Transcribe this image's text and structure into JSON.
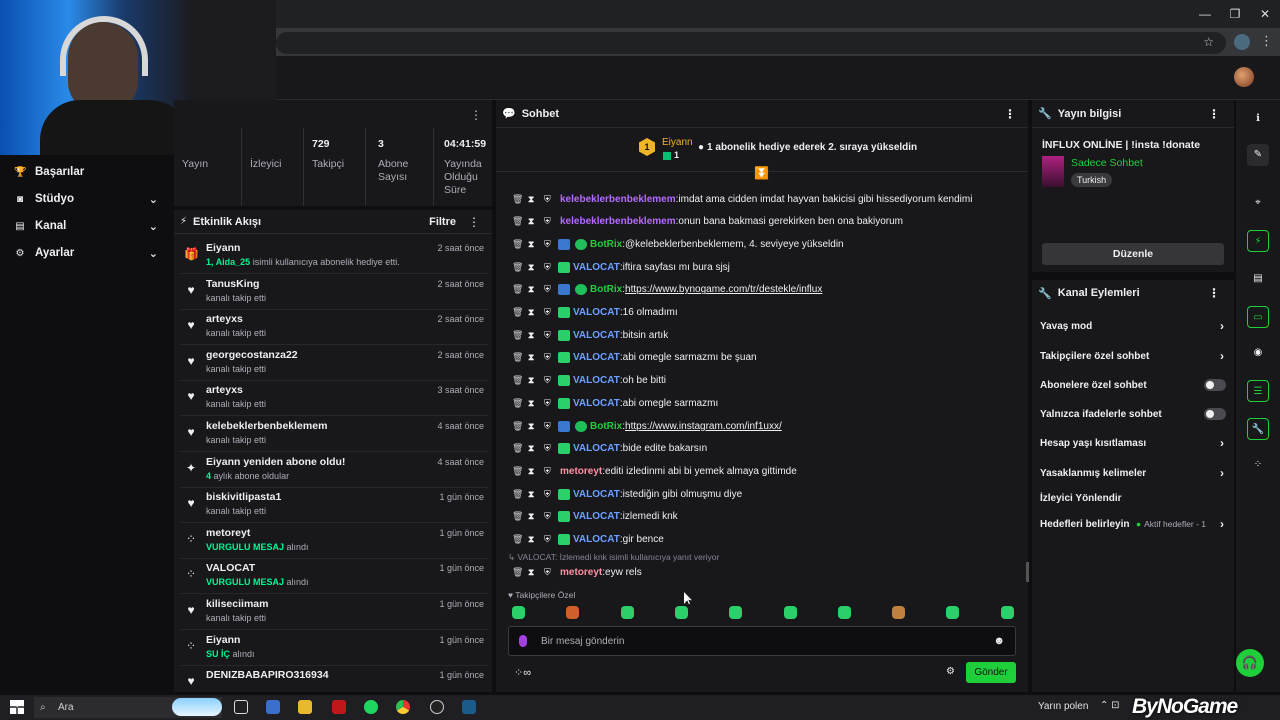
{
  "browser": {
    "window_controls": [
      "—",
      "❐",
      "✕"
    ]
  },
  "sidebar": {
    "items": [
      {
        "label": "Başarılar",
        "icon": "trophy-icon",
        "has_chevron": false
      },
      {
        "label": "Stüdyo",
        "icon": "studio-icon",
        "has_chevron": true
      },
      {
        "label": "Kanal",
        "icon": "channel-icon",
        "has_chevron": true
      },
      {
        "label": "Ayarlar",
        "icon": "gear-icon",
        "has_chevron": true
      }
    ]
  },
  "stats": [
    {
      "value": "",
      "label": "Yayın"
    },
    {
      "value": "",
      "label": "İzleyici"
    },
    {
      "value": "729",
      "label": "Takipçi"
    },
    {
      "value": "3",
      "label": "Abone Sayısı"
    },
    {
      "value": "04:41:59",
      "label": "Yayında Olduğu Süre"
    }
  ],
  "activity": {
    "title": "Etkinlik Akışı",
    "filter_label": "Filtre",
    "items": [
      {
        "icon": "gift-icon",
        "name": "Eiyann",
        "highlight": "1, Aida_25",
        "sub": " isimli kullanıcıya abonelik hediye etti.",
        "time": "2 saat önce"
      },
      {
        "icon": "heart-icon",
        "name": "TanusKing",
        "highlight": "",
        "sub": "kanalı takip etti",
        "time": "2 saat önce"
      },
      {
        "icon": "heart-icon",
        "name": "arteyxs",
        "highlight": "",
        "sub": "kanalı takip etti",
        "time": "2 saat önce"
      },
      {
        "icon": "heart-icon",
        "name": "georgecostanza22",
        "highlight": "",
        "sub": "kanalı takip etti",
        "time": "2 saat önce"
      },
      {
        "icon": "heart-icon",
        "name": "arteyxs",
        "highlight": "",
        "sub": "kanalı takip etti",
        "time": "3 saat önce"
      },
      {
        "icon": "heart-icon",
        "name": "kelebeklerbenbeklemem",
        "highlight": "",
        "sub": "kanalı takip etti",
        "time": "4 saat önce"
      },
      {
        "icon": "sparkle-icon",
        "name": "Eiyann yeniden abone oldu!",
        "highlight": "4",
        "sub": " aylık abone oldular",
        "time": "4 saat önce"
      },
      {
        "icon": "heart-icon",
        "name": "biskivitlipasta1",
        "highlight": "",
        "sub": "kanalı takip etti",
        "time": "1 gün önce"
      },
      {
        "icon": "points-icon",
        "name": "metoreyt",
        "highlight": "VURGULU MESAJ",
        "sub": " alındı",
        "time": "1 gün önce"
      },
      {
        "icon": "points-icon",
        "name": "VALOCAT",
        "highlight": "VURGULU MESAJ",
        "sub": " alındı",
        "time": "1 gün önce"
      },
      {
        "icon": "heart-icon",
        "name": "kiliseciimam",
        "highlight": "",
        "sub": "kanalı takip etti",
        "time": "1 gün önce"
      },
      {
        "icon": "points-icon",
        "name": "Eiyann",
        "highlight": "SU İÇ",
        "sub": " alındı",
        "time": "1 gün önce"
      },
      {
        "icon": "heart-icon",
        "name": "DENIZBABAPIRO316934",
        "highlight": "",
        "sub": "",
        "time": "1 gün önce"
      }
    ]
  },
  "chat": {
    "title": "Sohbet",
    "pinned": {
      "rank": "1",
      "name": "Eiyann",
      "count": "1",
      "message": "1 abonelik hediye ederek 2. sıraya yükseldin"
    },
    "messages": [
      {
        "badge": "",
        "user": "kelebeklerbenbeklemem",
        "color": "#b46bff",
        "text": "imdat ama cidden imdat hayvan bakicisi gibi hissediyorum kendimi",
        "link": false
      },
      {
        "badge": "",
        "user": "kelebeklerbenbeklemem",
        "color": "#b46bff",
        "text": "onun bana bakmasi gerekirken ben ona bakiyorum",
        "link": false
      },
      {
        "badge": "bot",
        "user": "BotRix",
        "color": "#1fcf3a",
        "text": "@kelebeklerbenbeklemem, 4. seviyeye yükseldin",
        "link": false
      },
      {
        "badge": "sub",
        "user": "VALOCAT",
        "color": "#6ea0ff",
        "text": "iftira sayfası mı bura sjsj",
        "link": false
      },
      {
        "badge": "bot",
        "user": "BotRix",
        "color": "#1fcf3a",
        "text": "https://www.bynogame.com/tr/destekle/influx",
        "link": true
      },
      {
        "badge": "sub",
        "user": "VALOCAT",
        "color": "#6ea0ff",
        "text": "16 olmadımı",
        "link": false
      },
      {
        "badge": "sub",
        "user": "VALOCAT",
        "color": "#6ea0ff",
        "text": "bitsin artık",
        "link": false
      },
      {
        "badge": "sub",
        "user": "VALOCAT",
        "color": "#6ea0ff",
        "text": "abi omegle sarmazmı be şuan",
        "link": false
      },
      {
        "badge": "sub",
        "user": "VALOCAT",
        "color": "#6ea0ff",
        "text": "oh be bitti",
        "link": false
      },
      {
        "badge": "sub",
        "user": "VALOCAT",
        "color": "#6ea0ff",
        "text": "abi omegle sarmazmı",
        "link": false
      },
      {
        "badge": "bot",
        "user": "BotRix",
        "color": "#1fcf3a",
        "text": "https://www.instagram.com/inf1uxx/",
        "link": true
      },
      {
        "badge": "sub",
        "user": "VALOCAT",
        "color": "#6ea0ff",
        "text": "bide edite bakarsın",
        "link": false
      },
      {
        "badge": "",
        "user": "metoreyt",
        "color": "#ff8fa3",
        "text": "editi izledinmi abi bi yemek almaya gittimde",
        "link": false
      },
      {
        "badge": "sub",
        "user": "VALOCAT",
        "color": "#6ea0ff",
        "text": "istediğin gibi olmuşmu diye",
        "link": false
      },
      {
        "badge": "sub",
        "user": "VALOCAT",
        "color": "#6ea0ff",
        "text": "izlemedi knk",
        "link": false
      },
      {
        "badge": "sub",
        "user": "VALOCAT",
        "color": "#6ea0ff",
        "text": "gir bence",
        "link": false
      },
      {
        "badge": "",
        "user": "metoreyt",
        "color": "#ff8fa3",
        "text": "eyw rels",
        "link": false
      }
    ],
    "reply_note": "↳ VALOCAT: İzlemedi knk isimli kullanıcıya yanıt veriyor",
    "emote_label": "♥ Takipçilere Özel",
    "emote_colors": [
      "#2bd06a",
      "#d0602a",
      "#2bd06a",
      "#2bd06a",
      "#2bd06a",
      "#2bd06a",
      "#2bd06a",
      "#c08040",
      "#2bd06a",
      "#2bd06a"
    ],
    "input_placeholder": "Bir mesaj gönderin",
    "send_label": "Gönder"
  },
  "stream_info": {
    "title": "Yayın bilgisi",
    "stream_title": "İNFLUX ONLİNE | !insta !donate",
    "category": "Sadece Sohbet",
    "tag": "Turkish",
    "edit_label": "Düzenle"
  },
  "channel_actions": {
    "title": "Kanal Eylemleri",
    "rows": [
      {
        "label": "Yavaş mod",
        "control": "chevron"
      },
      {
        "label": "Takipçilere özel sohbet",
        "control": "chevron"
      },
      {
        "label": "Abonelere özel sohbet",
        "control": "toggle"
      },
      {
        "label": "Yalnızca ifadelerle sohbet",
        "control": "toggle"
      },
      {
        "label": "Hesap yaşı kısıtlaması",
        "control": "chevron"
      },
      {
        "label": "Yasaklanmış kelimeler",
        "control": "chevron"
      },
      {
        "label": "İzleyici Yönlendir",
        "control": "none"
      },
      {
        "label": "Hedefleri belirleyin",
        "control": "goal"
      }
    ],
    "goal_text": "Aktif hedefler - 1"
  },
  "taskbar": {
    "search_label": "Ara",
    "weather": "Yarın polen",
    "watermark": "ByNoGame"
  },
  "colors": {
    "accent": "#1fcf3a",
    "background": "#0e0e10",
    "panel": "#18181b"
  }
}
